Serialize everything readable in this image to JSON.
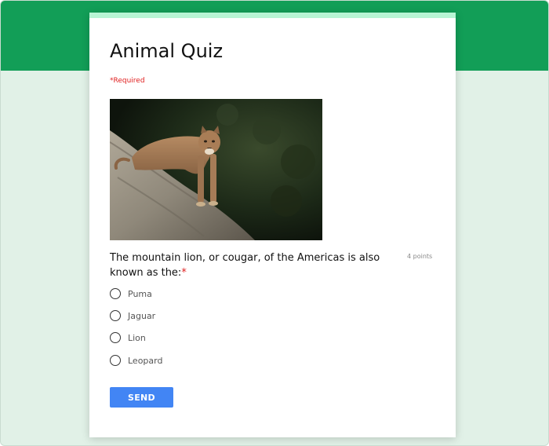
{
  "form": {
    "title": "Animal Quiz",
    "required_note": "*Required"
  },
  "question": {
    "text": "The mountain lion, or cougar, of the Americas is also known as the:",
    "required_mark": "*",
    "points": "4 points",
    "options": [
      {
        "label": "Puma"
      },
      {
        "label": "Jaguar"
      },
      {
        "label": "Lion"
      },
      {
        "label": "Leopard"
      }
    ]
  },
  "actions": {
    "send_label": "SEND"
  },
  "colors": {
    "banner": "#129e57",
    "background": "#e1f1e7",
    "card_accent": "#b7f5d4",
    "send_button": "#4285f4",
    "required": "#e02020"
  }
}
